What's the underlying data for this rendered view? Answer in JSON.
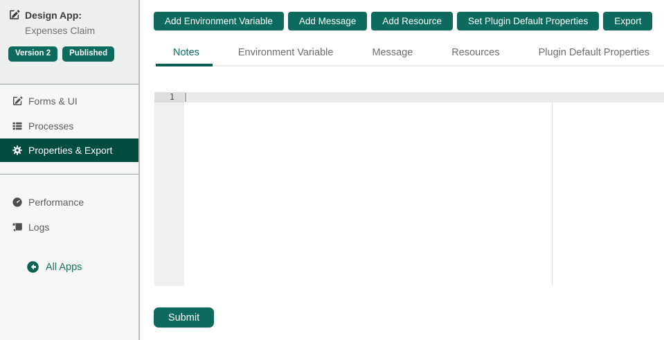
{
  "app": {
    "header": {
      "title": "Design App:",
      "app_name": "Expenses Claim",
      "version_badge": "Version 2",
      "status_badge": "Published"
    }
  },
  "sidebar": {
    "nav_primary": [
      {
        "label": "Forms & UI",
        "icon": "edit-square-icon",
        "active": false
      },
      {
        "label": "Processes",
        "icon": "list-icon",
        "active": false
      },
      {
        "label": "Properties & Export",
        "icon": "gear-icon",
        "active": true
      }
    ],
    "nav_secondary": [
      {
        "label": "Performance",
        "icon": "gauge-icon"
      },
      {
        "label": "Logs",
        "icon": "scroll-icon"
      }
    ],
    "back_link": {
      "label": "All Apps",
      "icon": "arrow-circle-left-icon"
    }
  },
  "toolbar": {
    "buttons": [
      "Add Environment Variable",
      "Add Message",
      "Add Resource",
      "Set Plugin Default Properties",
      "Export"
    ]
  },
  "tabs": {
    "active": "Notes",
    "items": [
      "Notes",
      "Environment Variable",
      "Message",
      "Resources",
      "Plugin Default Properties"
    ]
  },
  "editor": {
    "line_number": "1",
    "content": ""
  },
  "footer": {
    "submit_label": "Submit"
  },
  "colors": {
    "accent": "#0d6b5e",
    "accent_dark": "#004c3f",
    "active_tab_underline": "#0c5f52"
  }
}
